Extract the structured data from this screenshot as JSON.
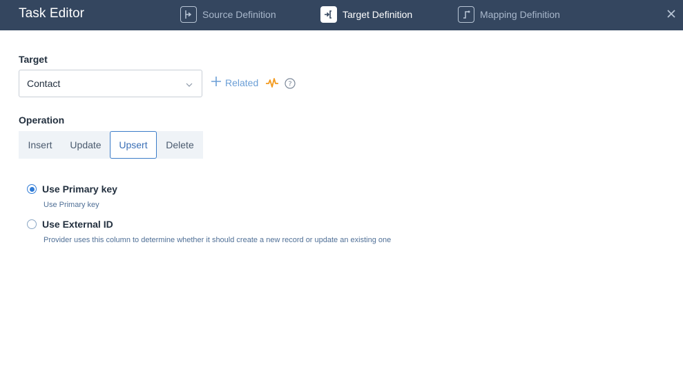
{
  "header": {
    "title": "Task Editor",
    "steps": [
      {
        "label": "Source Definition",
        "icon": "source-definition-icon",
        "active": false
      },
      {
        "label": "Target Definition",
        "icon": "target-definition-icon",
        "active": true
      },
      {
        "label": "Mapping Definition",
        "icon": "mapping-definition-icon",
        "active": false
      }
    ],
    "close_icon": "close-icon"
  },
  "target": {
    "label": "Target",
    "selected": "Contact",
    "related_label": "Related"
  },
  "operation": {
    "label": "Operation",
    "options": [
      "Insert",
      "Update",
      "Upsert",
      "Delete"
    ],
    "selected": "Upsert"
  },
  "key_options": [
    {
      "label": "Use Primary key",
      "description": "Use Primary key",
      "checked": true
    },
    {
      "label": "Use External ID",
      "description": "Provider uses this column to determine whether it should create a new record or update an existing one",
      "checked": false
    }
  ],
  "colors": {
    "header_bg": "#34465f",
    "accent": "#2f7bd6",
    "pulse": "#f39a1e"
  }
}
